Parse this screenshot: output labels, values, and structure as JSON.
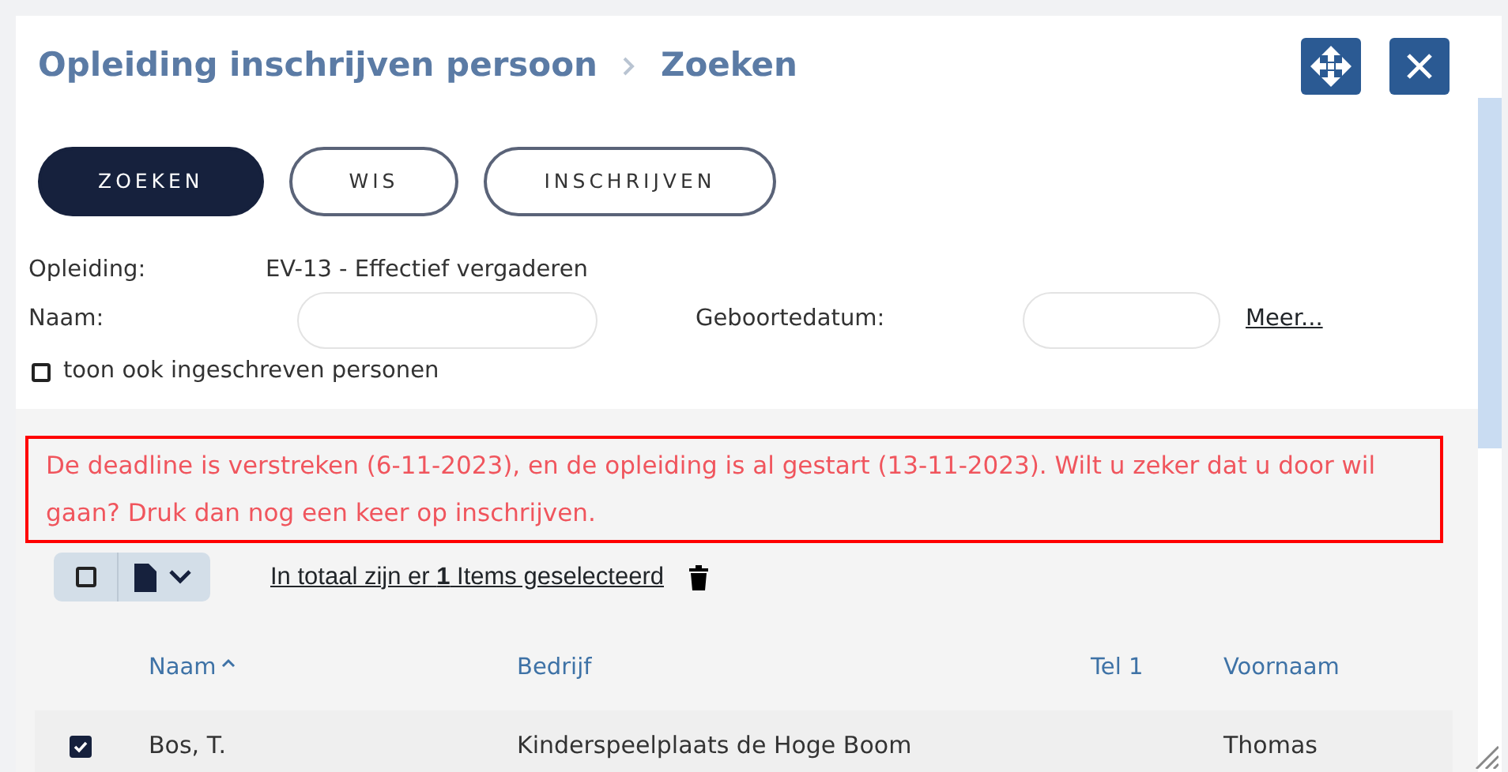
{
  "header": {
    "breadcrumb": [
      "Opleiding inschrijven persoon",
      "Zoeken"
    ]
  },
  "buttons": [
    {
      "label": "ZOEKEN",
      "kind": "primary"
    },
    {
      "label": "WIS",
      "kind": "outline"
    },
    {
      "label": "INSCHRIJVEN",
      "kind": "outline"
    }
  ],
  "form": {
    "opleiding_label": "Opleiding:",
    "opleiding_value": "EV-13 - Effectief vergaderen",
    "naam_label": "Naam:",
    "geboortedatum_label": "Geboortedatum:",
    "meer_link": "Meer...",
    "checkbox": {
      "label": "toon ook ingeschreven personen",
      "checked": false
    }
  },
  "alert": "De deadline is verstreken (6-11-2023), en de opleiding is al gestart (13-11-2023). Wilt u zeker dat u door wil gaan? Druk dan nog een keer op inschrijven.",
  "toolbar": {
    "select_all_checked": false,
    "summary": "In totaal zijn er **1** Items geselecteerd"
  },
  "table": {
    "columns": [
      {
        "label": "Naam",
        "sorted": true
      },
      {
        "label": "Bedrijf",
        "sorted": false
      },
      {
        "label": "Tel 1",
        "sorted": false
      },
      {
        "label": "Voornaam",
        "sorted": false
      }
    ],
    "rows": [
      {
        "selected": true,
        "naam": "Bos, T.",
        "bedrijf": "Kinderspeelplaats de Hoge Boom",
        "voornaam": "Thomas"
      }
    ]
  }
}
